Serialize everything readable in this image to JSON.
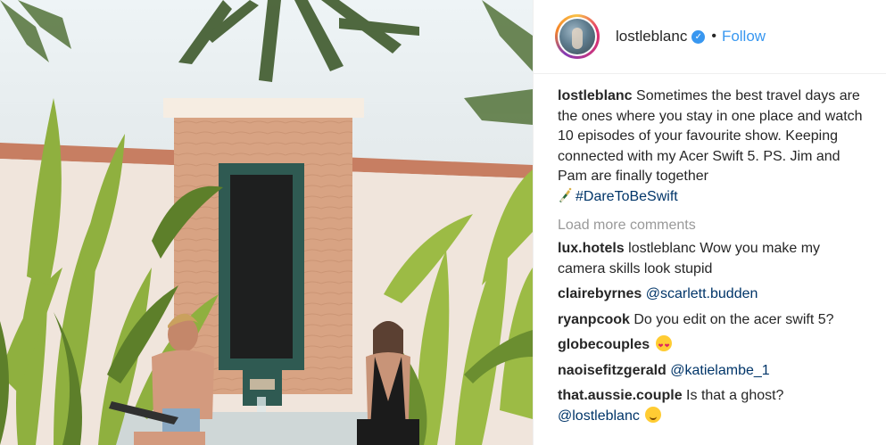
{
  "post": {
    "username": "lostleblanc",
    "follow_label": "Follow",
    "separator": "•",
    "caption": {
      "username": "lostleblanc",
      "text": "Sometimes the best travel days are the ones where you stay in one place and watch 10 episodes of your favourite show. Keeping connected with my Acer Swift 5. PS. Jim and Pam are finally together",
      "hashtag": "#DareToBeSwift"
    },
    "load_more_label": "Load more comments",
    "comments": [
      {
        "user": "lux.hotels",
        "text": "lostleblanc Wow you make my camera skills look stupid"
      },
      {
        "user": "clairebyrnes",
        "mention": "@scarlett.budden"
      },
      {
        "user": "ryanpcook",
        "text": "Do you edit on the acer swift 5?"
      },
      {
        "user": "globecouples"
      },
      {
        "user": "naoisefitzgerald",
        "mention": "@katielambe_1"
      },
      {
        "user": "that.aussie.couple",
        "text": "Is that a ghost?",
        "mention": "@lostleblanc"
      }
    ]
  },
  "icons": {
    "verified": "verified-badge-icon",
    "emoji_heart_eyes": "heart-eyes-emoji-icon",
    "emoji_hug": "hugging-face-emoji-icon",
    "bottle": "champagne-bottle-icon"
  },
  "colors": {
    "link_blue": "#3897f0",
    "hashtag_navy": "#003569",
    "muted_gray": "#999999",
    "text": "#262626"
  }
}
